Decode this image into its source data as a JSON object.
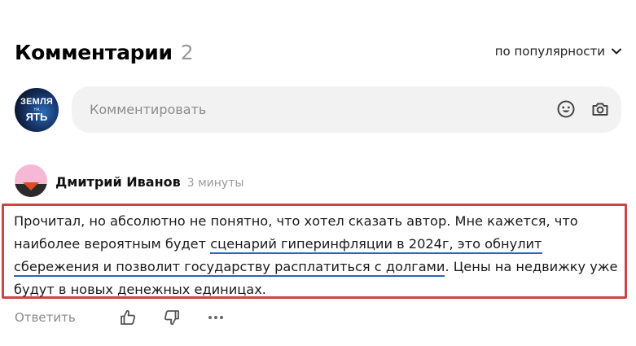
{
  "header": {
    "title": "Комментарии",
    "count": "2",
    "sort_label": "по популярности"
  },
  "composer": {
    "avatar_text_top": "ЗЕМЛЯ",
    "avatar_text_mid": "НА",
    "avatar_text_bottom": "ЯТЬ",
    "placeholder": "Комментировать"
  },
  "comment": {
    "author": "Дмитрий Иванов",
    "time": "3 минуты",
    "text_before": "Прочитал, но абсолютно не понятно, что хотел сказать автор. Мне кажется, что наиболее вероятным будет ",
    "text_underlined": "сценарий гиперинфляции в 2024г, это обнулит сбережения и позволит государству расплатиться с долгами",
    "text_after": ". Цены на недвижку уже будут в новых денежных единицах.",
    "reply_label": "Ответить"
  },
  "colors": {
    "highlight_border": "#cc4545",
    "underline": "#2f62b4",
    "input_bg": "#f2f2f2"
  },
  "icons": [
    "chevron-down-icon",
    "emoji-icon",
    "camera-icon",
    "thumbs-up-icon",
    "thumbs-down-icon",
    "more-icon"
  ]
}
